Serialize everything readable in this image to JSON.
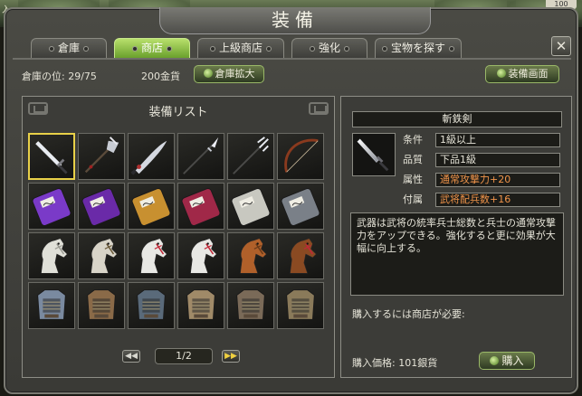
{
  "window": {
    "corner_label": "入",
    "corner_badge": "100",
    "title": "装備"
  },
  "tabs": [
    {
      "label": "倉庫",
      "active": false
    },
    {
      "label": "商店",
      "active": true
    },
    {
      "label": "上級商店",
      "active": false
    },
    {
      "label": "強化",
      "active": false
    },
    {
      "label": "宝物を探す",
      "active": false
    }
  ],
  "close_label": "✕",
  "toolbar": {
    "warehouse_text": "倉庫の位: 29/75",
    "gold_text": "200金貨",
    "expand_label": "倉庫拡大",
    "equip_screen_label": "装備画面"
  },
  "list": {
    "title": "装備リスト",
    "items": [
      {
        "name": "sword-1",
        "kind": "weapon",
        "icon": "sword-icon",
        "selected": true
      },
      {
        "name": "halberd-1",
        "kind": "weapon",
        "icon": "halberd-icon"
      },
      {
        "name": "saber-1",
        "kind": "weapon",
        "icon": "saber-icon"
      },
      {
        "name": "spear-1",
        "kind": "weapon",
        "icon": "spear-icon"
      },
      {
        "name": "trident-1",
        "kind": "weapon",
        "icon": "trident-icon"
      },
      {
        "name": "bow-1",
        "kind": "weapon",
        "icon": "bow-icon"
      },
      {
        "name": "book-purple-1",
        "kind": "book",
        "icon": "book-icon",
        "color": "#7a3ac8"
      },
      {
        "name": "book-purple-2",
        "kind": "book",
        "icon": "book-icon",
        "color": "#6a2aa8"
      },
      {
        "name": "book-gold",
        "kind": "book",
        "icon": "book-icon",
        "color": "#c89030"
      },
      {
        "name": "book-red",
        "kind": "book",
        "icon": "book-icon",
        "color": "#a02848"
      },
      {
        "name": "book-white",
        "kind": "book",
        "icon": "book-icon",
        "color": "#c8c8c0"
      },
      {
        "name": "book-grey",
        "kind": "book",
        "icon": "book-icon",
        "color": "#7a8088"
      },
      {
        "name": "horse-white-1",
        "kind": "horse",
        "icon": "horse-icon",
        "color": "#e0e0d8",
        "tack": "#9a9a92"
      },
      {
        "name": "horse-white-2",
        "kind": "horse",
        "icon": "horse-icon",
        "color": "#d8d4c8",
        "tack": "#6a5a3a"
      },
      {
        "name": "horse-white-3",
        "kind": "horse",
        "icon": "horse-icon",
        "color": "#e8e8e4",
        "tack": "#c02838"
      },
      {
        "name": "horse-white-4",
        "kind": "horse",
        "icon": "horse-icon",
        "color": "#e8e8e4",
        "tack": "#c02838"
      },
      {
        "name": "horse-brown-1",
        "kind": "horse",
        "icon": "horse-icon",
        "color": "#b0602a",
        "tack": "#6a3a18"
      },
      {
        "name": "horse-brown-2",
        "kind": "horse",
        "icon": "horse-icon",
        "color": "#8a4a22",
        "tack": "#c02838"
      },
      {
        "name": "armor-1",
        "kind": "armor",
        "icon": "armor-icon",
        "color": "#7a8aa0"
      },
      {
        "name": "armor-2",
        "kind": "armor",
        "icon": "armor-icon",
        "color": "#8a6a48"
      },
      {
        "name": "armor-3",
        "kind": "armor",
        "icon": "armor-icon",
        "color": "#5a6a7a"
      },
      {
        "name": "armor-4",
        "kind": "armor",
        "icon": "armor-icon",
        "color": "#a08a68"
      },
      {
        "name": "armor-5",
        "kind": "armor",
        "icon": "armor-icon",
        "color": "#7a6a58"
      },
      {
        "name": "armor-6",
        "kind": "armor",
        "icon": "armor-icon",
        "color": "#8a7a5a"
      }
    ],
    "page_text": "1/2",
    "prev_label": "◀◀",
    "next_label": "▶▶"
  },
  "detail": {
    "item_name": "斬鉄剣",
    "rows": [
      {
        "label": "条件",
        "value": "1級以上",
        "highlight": false
      },
      {
        "label": "品質",
        "value": "下品1級",
        "highlight": false
      },
      {
        "label": "属性",
        "value": "通常攻撃力+20",
        "highlight": true
      },
      {
        "label": "付属",
        "value": "武将配兵数+16",
        "highlight": true
      }
    ],
    "description": "武器は武将の統率兵士総数と兵士の通常攻撃力をアップできる。強化すると更に効果が大幅に向上する。",
    "requirement_text": "購入するには商店が必要:",
    "price_text": "購入価格: 101銀貨",
    "buy_label": "購入"
  },
  "colors": {
    "accent_green": "#8ac040",
    "selection_gold": "#e8d048",
    "highlight_orange": "#f0944a"
  }
}
